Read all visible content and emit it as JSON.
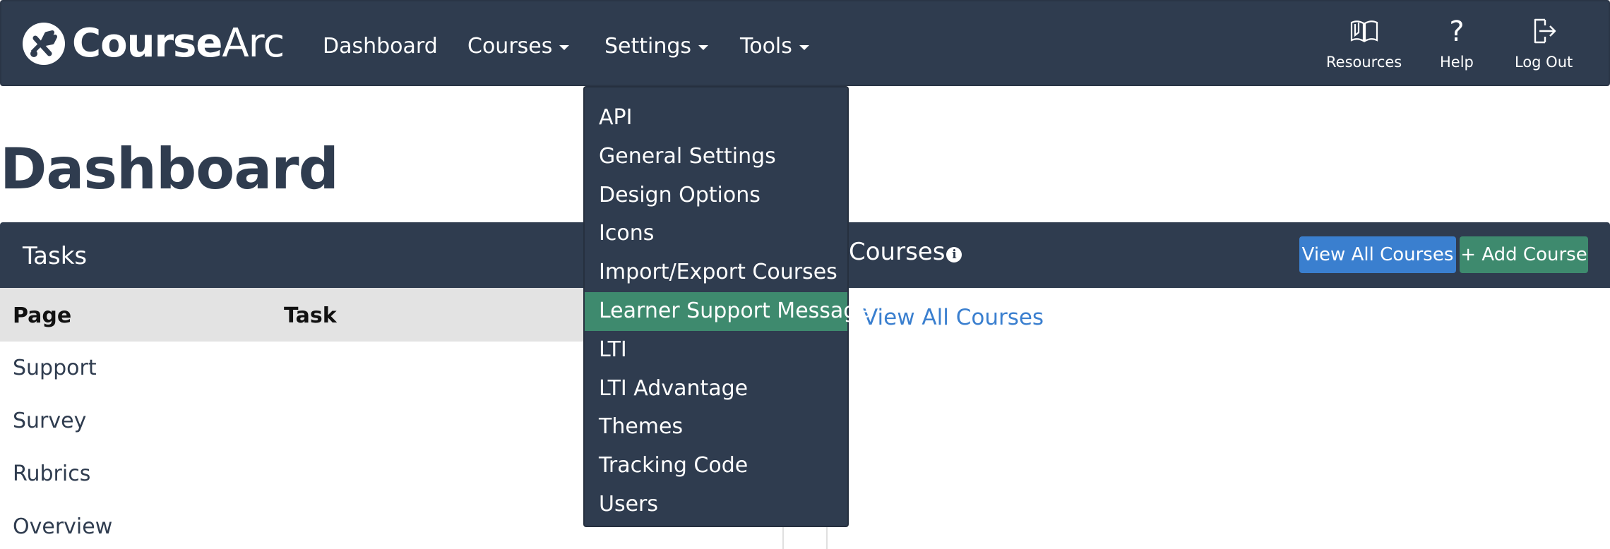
{
  "brand": {
    "name_bold": "Course",
    "name_light": "Arc"
  },
  "nav": {
    "dashboard": "Dashboard",
    "courses": "Courses",
    "settings": "Settings",
    "tools": "Tools"
  },
  "utility": {
    "resources": "Resources",
    "help": "Help",
    "logout": "Log Out"
  },
  "page": {
    "title": "Dashboard"
  },
  "tasks_panel": {
    "title": "Tasks",
    "columns": [
      "Page",
      "Task"
    ],
    "rows": [
      "Support",
      "Survey",
      "Rubrics",
      "Overview"
    ]
  },
  "courses_panel": {
    "title": "Courses",
    "info_icon": "i",
    "view_all_button": "View All Courses",
    "add_button": "+ Add Course",
    "link": "View All Courses"
  },
  "settings_menu": {
    "items": [
      "API",
      "General Settings",
      "Design Options",
      "Icons",
      "Import/Export Courses",
      "Learner Support Message",
      "LTI",
      "LTI Advantage",
      "Themes",
      "Tracking Code",
      "Users"
    ],
    "highlighted": "Learner Support Message"
  },
  "colors": {
    "navy": "#2f3c4f",
    "blue": "#3a7fcf",
    "green": "#3e8a6e",
    "table_header": "#e3e3e3"
  }
}
